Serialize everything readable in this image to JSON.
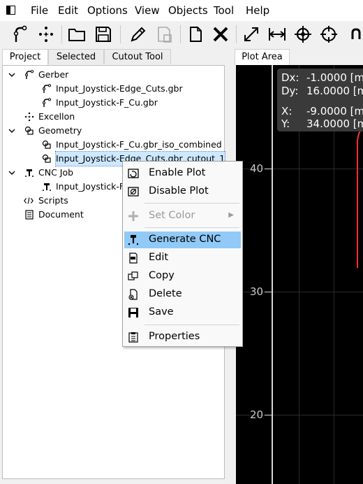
{
  "menubar": {
    "items": [
      "File",
      "Edit",
      "Options",
      "View",
      "Objects",
      "Tool",
      "Help"
    ]
  },
  "toolbar": {
    "icons": [
      "gerber-open-icon",
      "excellon-open-icon",
      "folder-open-icon",
      "save-icon",
      "edit-pencil-icon",
      "save-disabled-icon",
      "new-page-icon",
      "delete-x-icon",
      "zoom-fit-icon",
      "distance-icon",
      "target-icon",
      "crosshair-icon",
      "magnet-icon"
    ]
  },
  "left_tabs": [
    "Project",
    "Selected",
    "Cutout Tool"
  ],
  "tree": {
    "gerber": "Gerber",
    "gerber_items": [
      "Input_Joystick-Edge_Cuts.gbr",
      "Input_Joystick-F_Cu.gbr"
    ],
    "excellon": "Excellon",
    "geometry": "Geometry",
    "geometry_items": [
      "Input_Joystick-F_Cu.gbr_iso_combined",
      "Input_Joystick-Edge_Cuts.gbr_cutout_1"
    ],
    "cncjob": "CNC Job",
    "cncjob_items": [
      "Input_Joystick-F_"
    ],
    "scripts": "Scripts",
    "document": "Document"
  },
  "plot": {
    "tab_label": "Plot Area",
    "readout": {
      "dx_label": "Dx:",
      "dx": "-1.0000 [m",
      "dy_label": "Dy:",
      "dy": "16.0000 [m",
      "x_label": "X:",
      "x": "-9.0000 [m",
      "y_label": "Y:",
      "y": "34.0000 [m"
    },
    "y_ticks": [
      "40",
      "30",
      "20"
    ]
  },
  "context_menu": {
    "enable_plot": "Enable Plot",
    "disable_plot": "Disable Plot",
    "set_color": "Set Color",
    "generate_cnc": "Generate CNC",
    "edit": "Edit",
    "copy": "Copy",
    "delete": "Delete",
    "save": "Save",
    "properties": "Properties"
  },
  "colors": {
    "hover": "#91c9f7",
    "plot_bg": "#000000",
    "curve": "#ff3030"
  }
}
